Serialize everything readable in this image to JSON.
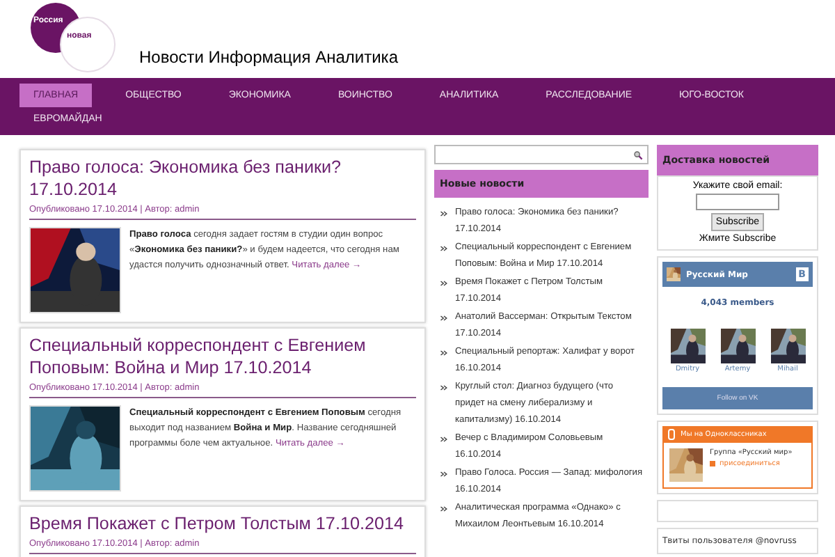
{
  "header": {
    "logo": {
      "top": "Россия",
      "bottom": "новая"
    },
    "tagline": "Новости Информация Аналитика"
  },
  "nav": [
    {
      "label": "ГЛАВНАЯ",
      "selected": true
    },
    {
      "label": "ОБЩЕСТВО",
      "selected": false
    },
    {
      "label": "ЭКОНОМИКА",
      "selected": false
    },
    {
      "label": "ВОИНСТВО",
      "selected": false
    },
    {
      "label": "АНАЛИТИКА",
      "selected": false
    },
    {
      "label": "РАССЛЕДОВАНИЕ",
      "selected": false
    },
    {
      "label": "ЮГО-ВОСТОК",
      "selected": false
    },
    {
      "label": "ЕВРОМАЙДАН",
      "selected": false
    }
  ],
  "posts": [
    {
      "title": "Право голоса: Экономика без паники? 17.10.2014",
      "meta": "Опубликовано 17.10.2014 | Автор: admin",
      "excerpt": "**Право голоса** сегодня задает гостям в студии один вопрос «**Экономика без паники?**» и будем надеется, что сегодня нам удастся получить однозначный ответ.",
      "more": "Читать далее →"
    },
    {
      "title": "Специальный корреспондент с Евгением Поповым: Война и Мир 17.10.2014",
      "meta": "Опубликовано 17.10.2014 | Автор: admin",
      "excerpt": "**Специальный корреспондент с Евгением Поповым** сегодня выходит под названием **Война и Мир**. Название сегодняшней программы боле чем актуальное.",
      "more": "Читать далее →"
    },
    {
      "title": "Время Покажет с Петром Толстым 17.10.2014",
      "meta": "Опубликовано 17.10.2014 | Автор: admin"
    }
  ],
  "sidebar": {
    "news_title": "Новые новости",
    "news": [
      "Право голоса: Экономика без паники? 17.10.2014",
      "Специальный корреспондент с Евгением Поповым: Война и Мир 17.10.2014",
      "Время Покажет с Петром Толстым 17.10.2014",
      "Анатолий Вассерман: Открытым Текстом 17.10.2014",
      "Специальный репортаж: Халифат у ворот 16.10.2014",
      "Круглый стол: Диагноз будущего (что придет на смену либерализму и капитализму) 16.10.2014",
      "Вечер с Владимиром Соловьевым 16.10.2014",
      "Право Голоса. Россия — Запад: мифология 16.10.2014",
      "Аналитическая программа «Однако» с Михаилом Леонтьевым 16.10.2014"
    ]
  },
  "right": {
    "delivery": {
      "title": "Доставка новостей",
      "label": "Укажите свой email:",
      "button": "Subscribe",
      "note": "Жмите Subscribe"
    },
    "vk": {
      "group": "Русский Мир",
      "badge": "B",
      "members_count": "4,043 members",
      "members": [
        "Dmitry",
        "Artemy",
        "Mihail"
      ],
      "follow": "Follow on VK"
    },
    "ok": {
      "title": "Мы на Одноклассниках",
      "group": "Группа «Русский мир»",
      "join": "присоединиться"
    },
    "twitter": "Твиты пользователя @novruss"
  }
}
